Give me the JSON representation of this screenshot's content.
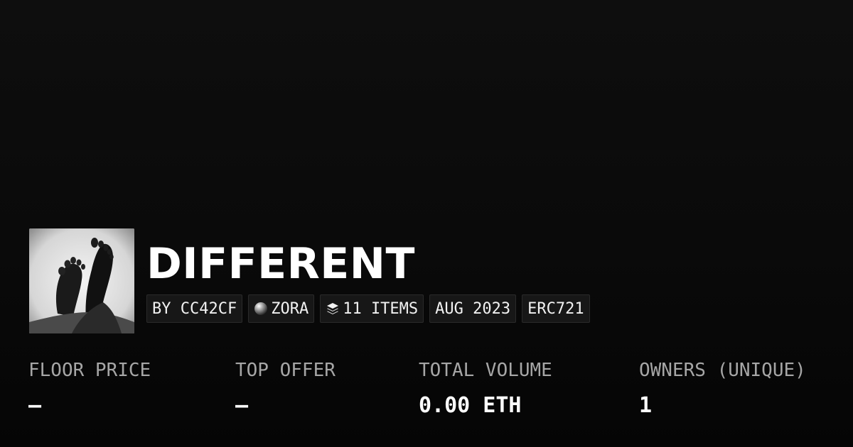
{
  "collection": {
    "title": "DIFFERENT",
    "thumbnail_icon": "feet-photo-image"
  },
  "badges": {
    "creator": "BY CC42CF",
    "chain": "ZORA",
    "chain_icon": "zora-orb-icon",
    "items": "11 ITEMS",
    "items_icon": "layers-icon",
    "date": "AUG 2023",
    "standard": "ERC721"
  },
  "stats": {
    "floor_price": {
      "label": "FLOOR PRICE",
      "value": "–"
    },
    "top_offer": {
      "label": "TOP OFFER",
      "value": "–"
    },
    "total_volume": {
      "label": "TOTAL VOLUME",
      "value": "0.00 ETH"
    },
    "owners": {
      "label": "OWNERS (UNIQUE)",
      "value": "1"
    }
  },
  "colors": {
    "background": "#0b0b0b",
    "badge_bg": "#171717",
    "label_gray": "#a6a6a6",
    "text": "#ffffff"
  }
}
